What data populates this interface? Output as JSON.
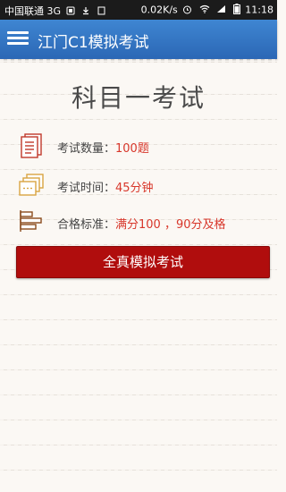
{
  "status_bar": {
    "carrier": "中国联通 3G",
    "speed": "0.02K/s",
    "time": "11:18",
    "icons": [
      "phone-icon",
      "download-icon",
      "sim-icon",
      "alarm-icon",
      "wifi-icon",
      "signal-icon",
      "battery-icon"
    ]
  },
  "header": {
    "title": "江门C1模拟考试",
    "menu_icon": "hamburger-menu-icon",
    "bg_color": "#2f72c0"
  },
  "main": {
    "heading": "科目一考试",
    "rows": [
      {
        "label": "考试数量：",
        "value": "100题",
        "icon": "document-list-icon"
      },
      {
        "label": "考试时间：",
        "value": "45分钟",
        "icon": "stacked-sheets-icon"
      },
      {
        "label": "合格标准：",
        "value": "满分100 ，90分及格",
        "icon": "bars-icon"
      }
    ],
    "value_color": "#d8372b",
    "button_label": "全真模拟考试",
    "button_color": "#b00d0d"
  }
}
